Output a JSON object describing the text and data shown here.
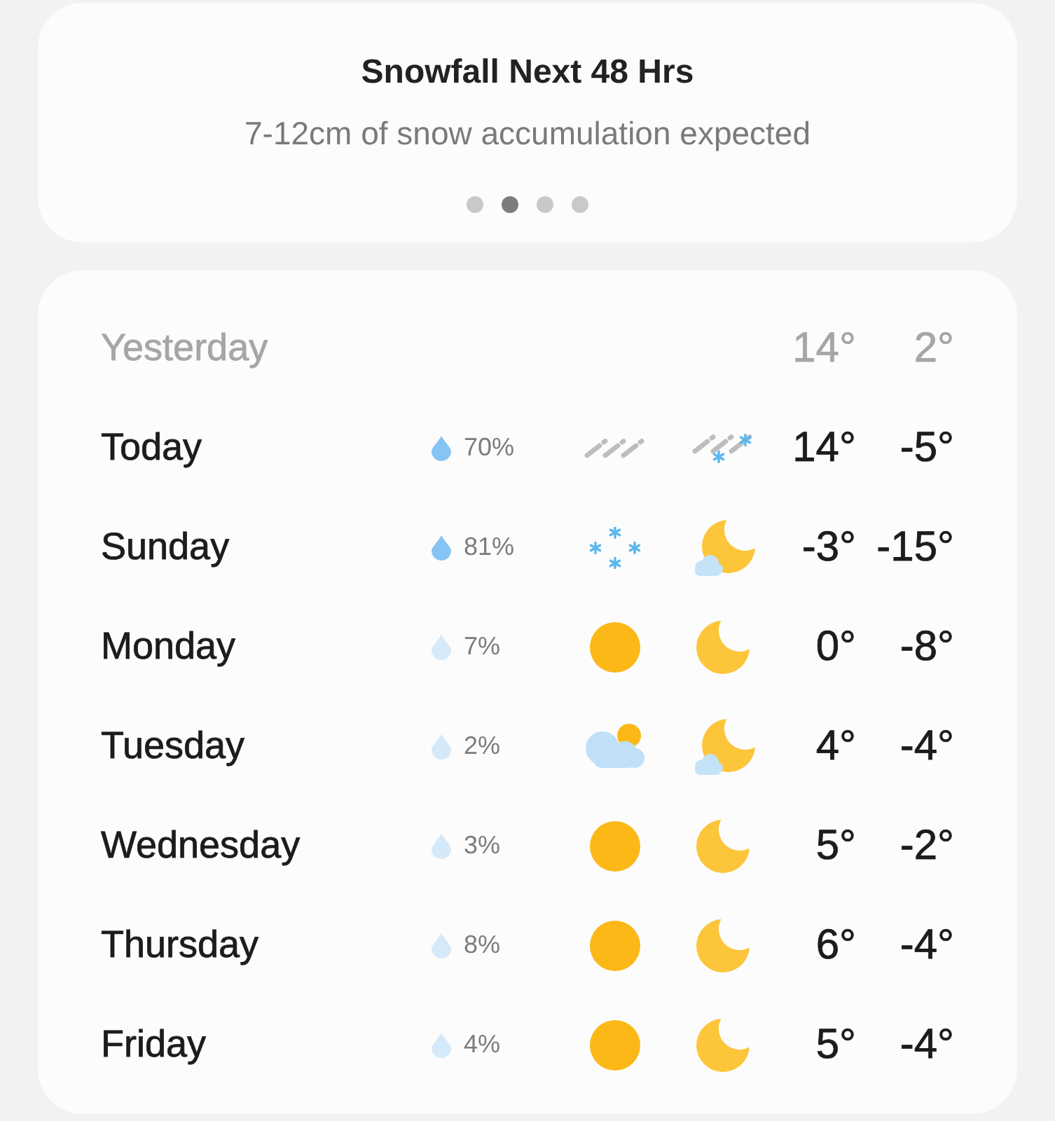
{
  "banner": {
    "title": "Snowfall Next 48 Hrs",
    "subtitle": "7-12cm of snow accumulation expected",
    "pages": [
      {
        "selected": false
      },
      {
        "selected": true
      },
      {
        "selected": false
      },
      {
        "selected": false
      }
    ]
  },
  "forecast": {
    "yesterday": {
      "label": "Yesterday",
      "high": "14°",
      "low": "2°"
    },
    "days": [
      {
        "day": "Today",
        "precip": "70%",
        "high_chance": true,
        "day_icon": {
          "kind": "rain"
        },
        "night_icon": {
          "kind": "rain-snow"
        },
        "high": "14°",
        "low": "-5°"
      },
      {
        "day": "Sunday",
        "precip": "81%",
        "high_chance": true,
        "day_icon": {
          "kind": "snow"
        },
        "night_icon": {
          "kind": "moon-cloud"
        },
        "high": "-3°",
        "low": "-15°"
      },
      {
        "day": "Monday",
        "precip": "7%",
        "high_chance": false,
        "day_icon": {
          "kind": "sun"
        },
        "night_icon": {
          "kind": "moon"
        },
        "high": "0°",
        "low": "-8°"
      },
      {
        "day": "Tuesday",
        "precip": "2%",
        "high_chance": false,
        "day_icon": {
          "kind": "sun-cloud"
        },
        "night_icon": {
          "kind": "moon-cloud"
        },
        "high": "4°",
        "low": "-4°"
      },
      {
        "day": "Wednesday",
        "precip": "3%",
        "high_chance": false,
        "day_icon": {
          "kind": "sun"
        },
        "night_icon": {
          "kind": "moon"
        },
        "high": "5°",
        "low": "-2°"
      },
      {
        "day": "Thursday",
        "precip": "8%",
        "high_chance": false,
        "day_icon": {
          "kind": "sun"
        },
        "night_icon": {
          "kind": "moon"
        },
        "high": "6°",
        "low": "-4°"
      },
      {
        "day": "Friday",
        "precip": "4%",
        "high_chance": false,
        "day_icon": {
          "kind": "sun"
        },
        "night_icon": {
          "kind": "moon"
        },
        "high": "5°",
        "low": "-4°"
      }
    ]
  }
}
